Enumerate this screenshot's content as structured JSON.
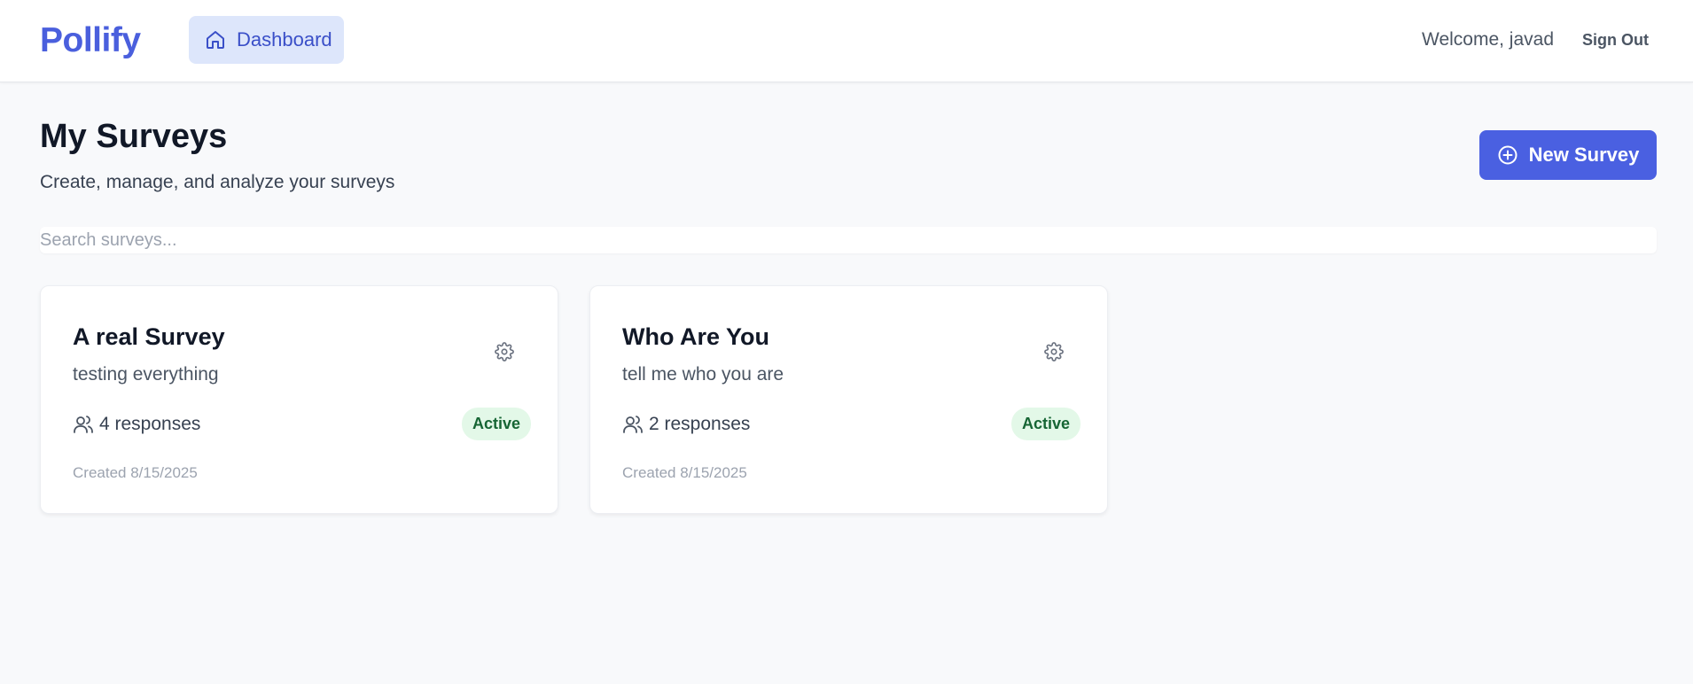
{
  "nav": {
    "brand": "Pollify",
    "dashboard_label": "Dashboard",
    "welcome": "Welcome, javad",
    "signout_label": "Sign Out"
  },
  "page": {
    "title": "My Surveys",
    "subtitle": "Create, manage, and analyze your surveys",
    "new_survey_label": "New Survey",
    "search_placeholder": "Search surveys..."
  },
  "surveys": [
    {
      "title": "A real Survey",
      "description": "testing everything",
      "responses": "4 responses",
      "status": "Active",
      "created": "Created 8/15/2025"
    },
    {
      "title": "Who Are You",
      "description": "tell me who you are",
      "responses": "2 responses",
      "status": "Active",
      "created": "Created 8/15/2025"
    }
  ],
  "colors": {
    "brand": "#4a5fdd",
    "primary_button": "#4a60e1",
    "nav_active_bg": "#dde6fb",
    "status_active_bg": "#e3f8e8",
    "status_active_text": "#166534"
  },
  "icons": {
    "dashboard": "home-icon",
    "new_survey": "plus-circle-icon",
    "card_settings": "gear-icon",
    "responses": "users-icon"
  }
}
